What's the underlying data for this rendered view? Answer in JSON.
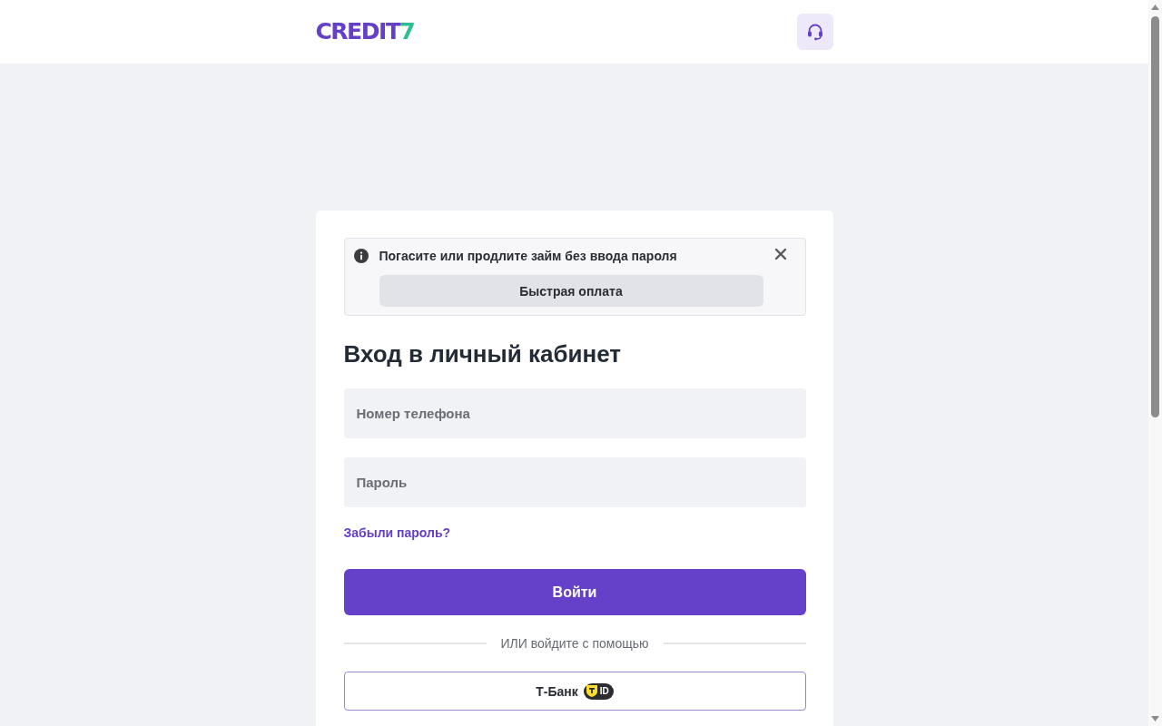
{
  "header": {
    "logo": {
      "text": "CREDIT",
      "accent": "7"
    }
  },
  "notice": {
    "text": "Погасите или продлите займ без ввода пароля",
    "button": "Быстрая оплата"
  },
  "login": {
    "title": "Вход в личный кабинет",
    "fields": [
      {
        "placeholder": "Номер телефона"
      },
      {
        "placeholder": "Пароль"
      }
    ],
    "forgot_link": "Забыли пароль?",
    "submit": "Войти",
    "divider": "ИЛИ войдите с помощью",
    "alt_login": {
      "label": "Т-Банк",
      "badge": "ID"
    }
  }
}
